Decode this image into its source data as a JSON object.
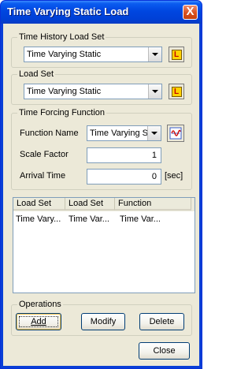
{
  "window": {
    "title": "Time Varying Static Load",
    "close_glyph": "X"
  },
  "time_history_load_set": {
    "label": "Time History Load Set",
    "value": "Time Varying Static",
    "button_icon": "load-set-icon"
  },
  "load_set": {
    "label": "Load Set",
    "value": "Time Varying Static",
    "button_icon": "load-set-icon"
  },
  "time_forcing_function": {
    "label": "Time Forcing Function",
    "function_name_label": "Function Name",
    "function_name_value": "Time Varying St",
    "graph_icon": "function-graph-icon",
    "scale_factor_label": "Scale Factor",
    "scale_factor_value": "1",
    "arrival_time_label": "Arrival Time",
    "arrival_time_value": "0",
    "arrival_time_unit": "[sec]"
  },
  "table": {
    "columns": [
      "Load Set",
      "Load Set",
      "Function"
    ],
    "rows": [
      [
        "Time Vary...",
        "Time Var...",
        "Time Var..."
      ]
    ]
  },
  "operations": {
    "label": "Operations",
    "add": "Add",
    "modify": "Modify",
    "delete": "Delete"
  },
  "close_button": "Close",
  "colors": {
    "title_blue": "#0046e0",
    "face": "#ece9d8",
    "close_red": "#d9501f"
  }
}
